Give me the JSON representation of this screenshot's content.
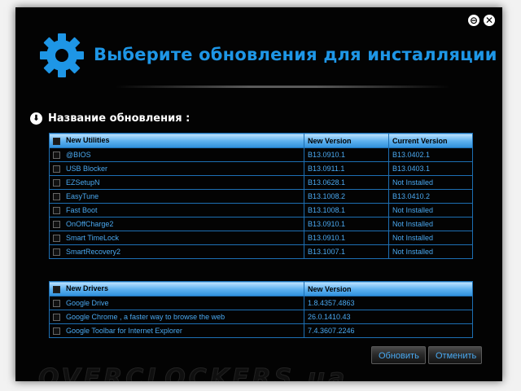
{
  "window": {
    "title": "Выберите обновления для инсталляции",
    "minimize_glyph": "⊖",
    "close_glyph": "✕",
    "app_icon": "gear-icon"
  },
  "section": {
    "icon": "download-icon",
    "label": "Название обновления :"
  },
  "utilities": {
    "headers": [
      "New Utilities",
      "New Version",
      "Current Version"
    ],
    "rows": [
      {
        "name": "@BIOS",
        "new_version": "B13.0910.1",
        "current_version": "B13.0402.1"
      },
      {
        "name": "USB Blocker",
        "new_version": "B13.0911.1",
        "current_version": "B13.0403.1"
      },
      {
        "name": "EZSetupN",
        "new_version": "B13.0628.1",
        "current_version": "Not Installed"
      },
      {
        "name": "EasyTune",
        "new_version": "B13.1008.2",
        "current_version": "B13.0410.2"
      },
      {
        "name": "Fast Boot",
        "new_version": "B13.1008.1",
        "current_version": "Not Installed"
      },
      {
        "name": "OnOffCharge2",
        "new_version": "B13.0910.1",
        "current_version": "Not Installed"
      },
      {
        "name": "Smart TimeLock",
        "new_version": "B13.0910.1",
        "current_version": "Not Installed"
      },
      {
        "name": "SmartRecovery2",
        "new_version": "B13.1007.1",
        "current_version": "Not Installed"
      }
    ]
  },
  "drivers": {
    "headers": [
      "New Drivers",
      "New Version"
    ],
    "rows": [
      {
        "name": "Google Drive",
        "new_version": "1.8.4357.4863"
      },
      {
        "name": "Google Chrome , a faster way to browse the web",
        "new_version": "26.0.1410.43"
      },
      {
        "name": "Google Toolbar for Internet Explorer",
        "new_version": "7.4.3607.2246"
      }
    ]
  },
  "buttons": {
    "update_label": "Обновить",
    "cancel_label": "Отменить"
  },
  "watermark": "OVERCLOCKERS.ua",
  "colors": {
    "accent": "#1e96e6",
    "header_gradient_top": "#bfe4ff",
    "header_gradient_bottom": "#2e8fdb",
    "table_border": "#1d6fb3",
    "background": "#030303"
  }
}
